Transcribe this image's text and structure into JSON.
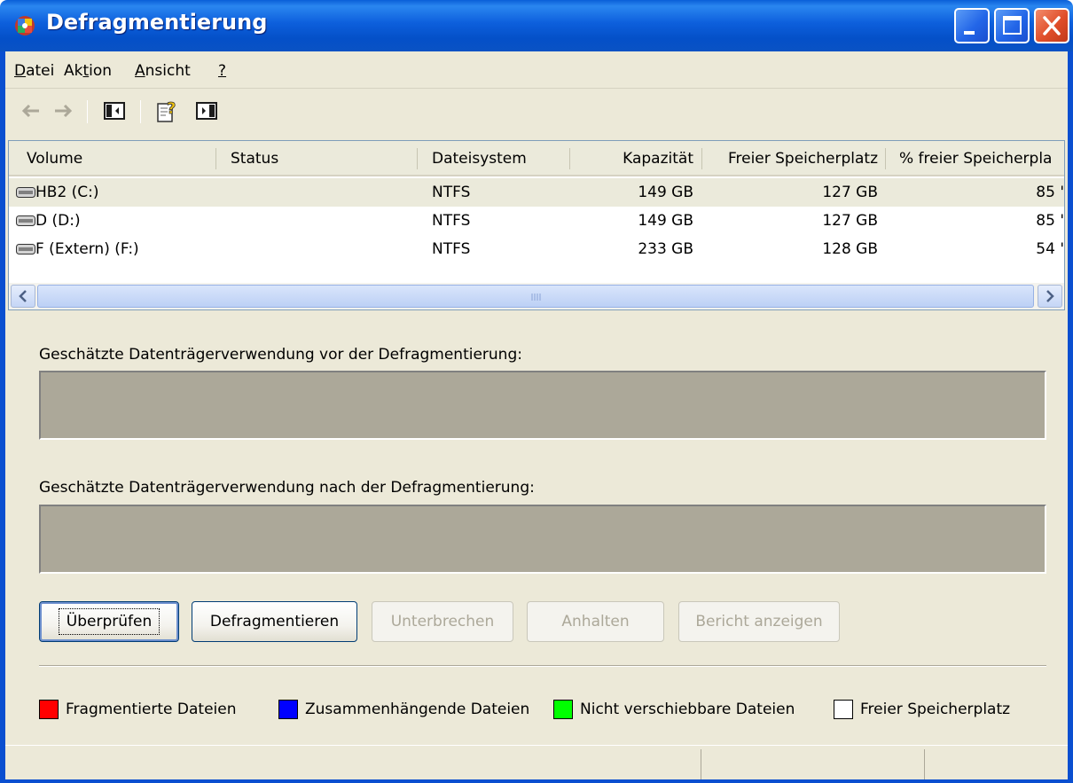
{
  "window": {
    "title": "Defragmentierung"
  },
  "menu": {
    "items": [
      {
        "label": "Datei",
        "accel": "D"
      },
      {
        "label": "Aktion",
        "accel": "t"
      },
      {
        "label": "Ansicht",
        "accel": "A"
      },
      {
        "label": "?",
        "accel": "?"
      }
    ]
  },
  "toolbar": {
    "buttons": [
      "back-arrow-icon",
      "forward-arrow-icon",
      "show-hide-console-tree-icon",
      "help-icon",
      "show-hide-action-pane-icon"
    ]
  },
  "volumes": {
    "columns": [
      "Volume",
      "Status",
      "Dateisystem",
      "Kapazität",
      "Freier Speicherplatz",
      "% freier Speicherpla"
    ],
    "rows": [
      {
        "volume": "HB2 (C:)",
        "status": "",
        "filesystem": "NTFS",
        "capacity": "149 GB",
        "free": "127 GB",
        "free_pct": "85 '"
      },
      {
        "volume": "D (D:)",
        "status": "",
        "filesystem": "NTFS",
        "capacity": "149 GB",
        "free": "127 GB",
        "free_pct": "85 '"
      },
      {
        "volume": "F (Extern) (F:)",
        "status": "",
        "filesystem": "NTFS",
        "capacity": "233 GB",
        "free": "128 GB",
        "free_pct": "54 '"
      }
    ]
  },
  "panel": {
    "before_label": "Geschätzte Datenträgerverwendung vor der Defragmentierung:",
    "after_label": "Geschätzte Datenträgerverwendung nach der Defragmentierung:"
  },
  "buttons": {
    "analyze": "Überprüfen",
    "defragment": "Defragmentieren",
    "pause": "Unterbrechen",
    "stop": "Anhalten",
    "report": "Bericht anzeigen"
  },
  "legend": {
    "items": [
      {
        "label": "Fragmentierte Dateien",
        "color": "#ff0000"
      },
      {
        "label": "Zusammenhängende Dateien",
        "color": "#0000ff"
      },
      {
        "label": "Nicht verschiebbare Dateien",
        "color": "#00ff00"
      },
      {
        "label": "Freier Speicherplatz",
        "color": "#ffffff"
      }
    ]
  },
  "colors": {
    "titlebar": "#0a5fd8",
    "usage_bar": "#aca899"
  }
}
